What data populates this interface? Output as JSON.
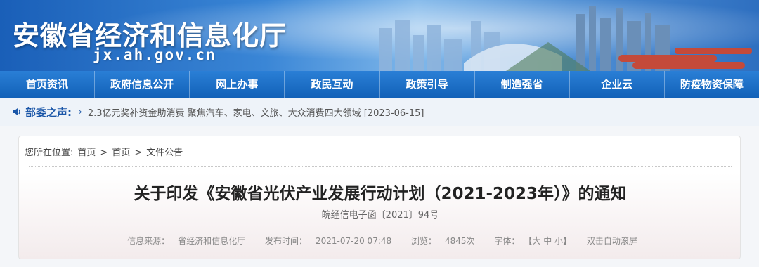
{
  "banner": {
    "title": "安徽省经济和信息化厅",
    "domain": "jx.ah.gov.cn"
  },
  "nav": {
    "items": [
      "首页资讯",
      "政府信息公开",
      "网上办事",
      "政民互动",
      "政策引导",
      "制造强省",
      "企业云",
      "防疫物资保障"
    ]
  },
  "notice": {
    "label": "部委之声:",
    "arrow": "›",
    "text": "2.3亿元奖补资金助消费 聚焦汽车、家电、文旅、大众消费四大领域 [2023-06-15]",
    "icon": "speaker-icon"
  },
  "breadcrumb": {
    "prefix": "您所在位置:",
    "items": [
      "首页",
      "首页",
      "文件公告"
    ],
    "separator": ">"
  },
  "article": {
    "title": "关于印发《安徽省光伏产业发展行动计划（2021-2023年）》的通知",
    "doc_number": "皖经信电子函〔2021〕94号",
    "meta": {
      "source_label": "信息来源：",
      "source": "省经济和信息化厅",
      "time_label": "发布时间：",
      "time": "2021-07-20 07:48",
      "views_label": "浏览：",
      "views": "4845次",
      "font_label": "字体：",
      "font_sizes": "【大 中 小】",
      "autoscroll": "双击自动滚屏"
    }
  },
  "colors": {
    "nav_bg": "#1565bd",
    "accent": "#1a56a8"
  }
}
